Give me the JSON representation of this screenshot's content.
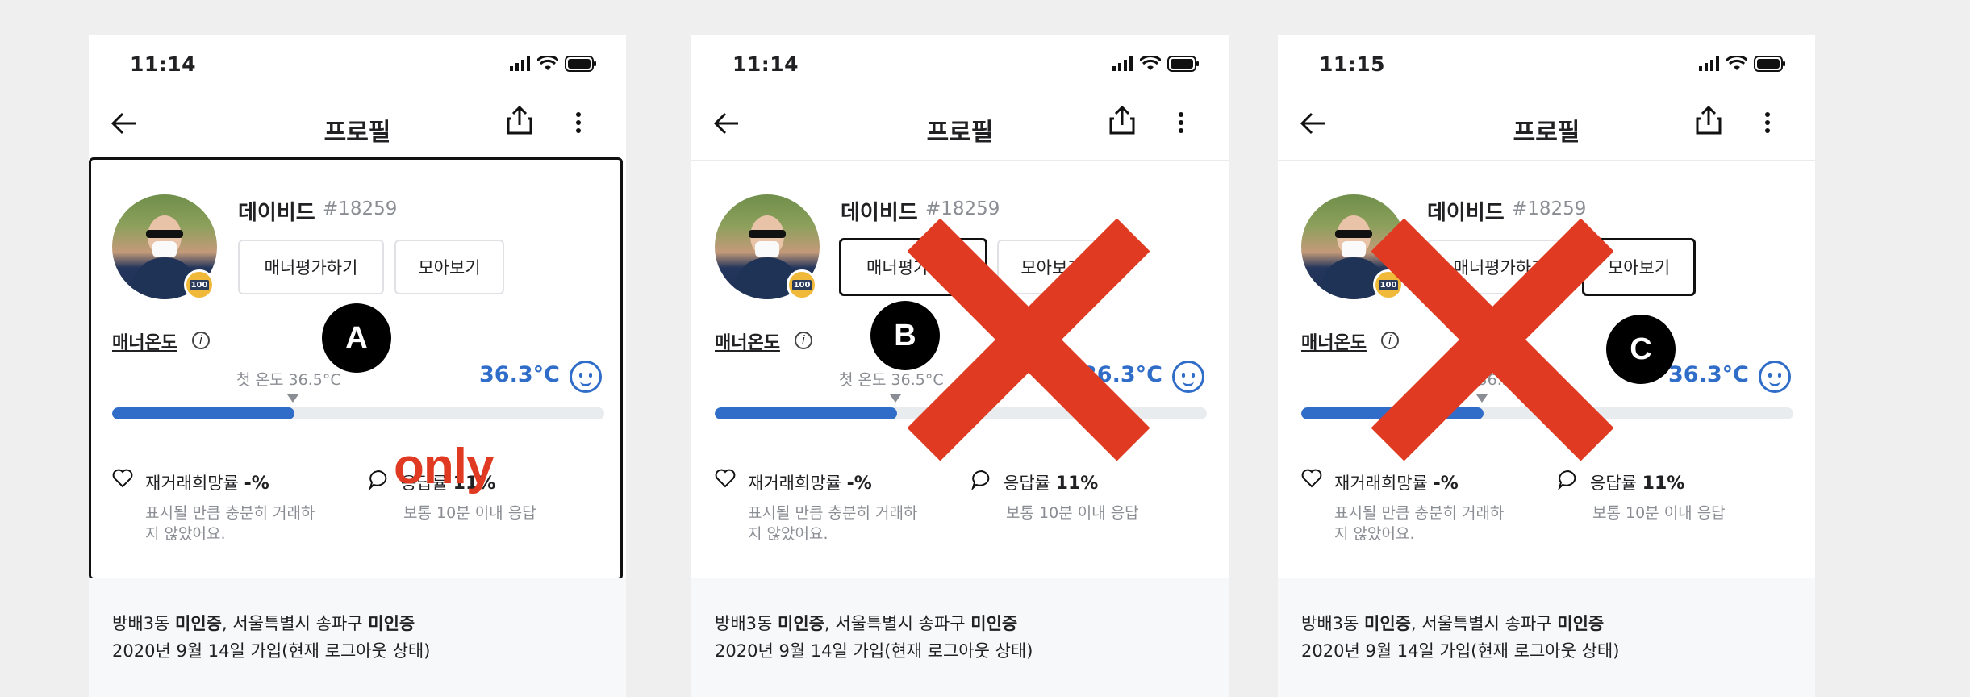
{
  "colors": {
    "accent": "#2f6dc8",
    "cross": "#e03a22",
    "only": "#e03a22"
  },
  "screens": [
    {
      "time": "11:14",
      "title": "프로필",
      "name": "데이비드",
      "user_id": "#18259",
      "btn_manner": "매너평가하기",
      "btn_collect": "모아보기",
      "manner_label": "매너온도",
      "first_temp": "첫 온도 36.5°C",
      "temp": "36.3°C",
      "rehire_label": "재거래희망률",
      "rehire_value": "-%",
      "rehire_desc1": "표시될 만큼 충분히 거래하",
      "rehire_desc2": "지 않았어요.",
      "response_label": "응답률",
      "response_value": "11%",
      "response_desc": "보통 10분 이내 응답",
      "loc_a": "방배3동",
      "loc_a_status": "미인증",
      "loc_b": "서울특별시 송파구",
      "loc_b_status": "미인증",
      "joined": "2020년 9월 14일 가입(현재 로그아웃 상태)",
      "marker": "A",
      "note": "only",
      "selected_button": "none",
      "crossed": false,
      "manner_temp_fill_fraction": 0.37
    },
    {
      "time": "11:14",
      "title": "프로필",
      "name": "데이비드",
      "user_id": "#18259",
      "btn_manner": "매너평가하기",
      "btn_collect": "모아보기",
      "manner_label": "매너온도",
      "first_temp": "첫 온도 36.5°C",
      "temp": "36.3°C",
      "rehire_label": "재거래희망률",
      "rehire_value": "-%",
      "rehire_desc1": "표시될 만큼 충분히 거래하",
      "rehire_desc2": "지 않았어요.",
      "response_label": "응답률",
      "response_value": "11%",
      "response_desc": "보통 10분 이내 응답",
      "loc_a": "방배3동",
      "loc_a_status": "미인증",
      "loc_b": "서울특별시 송파구",
      "loc_b_status": "미인증",
      "joined": "2020년 9월 14일 가입(현재 로그아웃 상태)",
      "marker": "B",
      "selected_button": "manner",
      "crossed": true,
      "manner_temp_fill_fraction": 0.37
    },
    {
      "time": "11:15",
      "title": "프로필",
      "name": "데이비드",
      "user_id": "#18259",
      "btn_manner": "매너평가하기",
      "btn_collect": "모아보기",
      "manner_label": "매너온도",
      "first_temp": "첫 온도 36.5°C",
      "temp": "36.3°C",
      "rehire_label": "재거래희망률",
      "rehire_value": "-%",
      "rehire_desc1": "표시될 만큼 충분히 거래하",
      "rehire_desc2": "지 않았어요.",
      "response_label": "응답률",
      "response_value": "11%",
      "response_desc": "보통 10분 이내 응답",
      "loc_a": "방배3동",
      "loc_a_status": "미인증",
      "loc_b": "서울특별시 송파구",
      "loc_b_status": "미인증",
      "joined": "2020년 9월 14일 가입(현재 로그아웃 상태)",
      "marker": "C",
      "selected_button": "collect",
      "crossed": true,
      "manner_temp_fill_fraction": 0.37
    }
  ]
}
